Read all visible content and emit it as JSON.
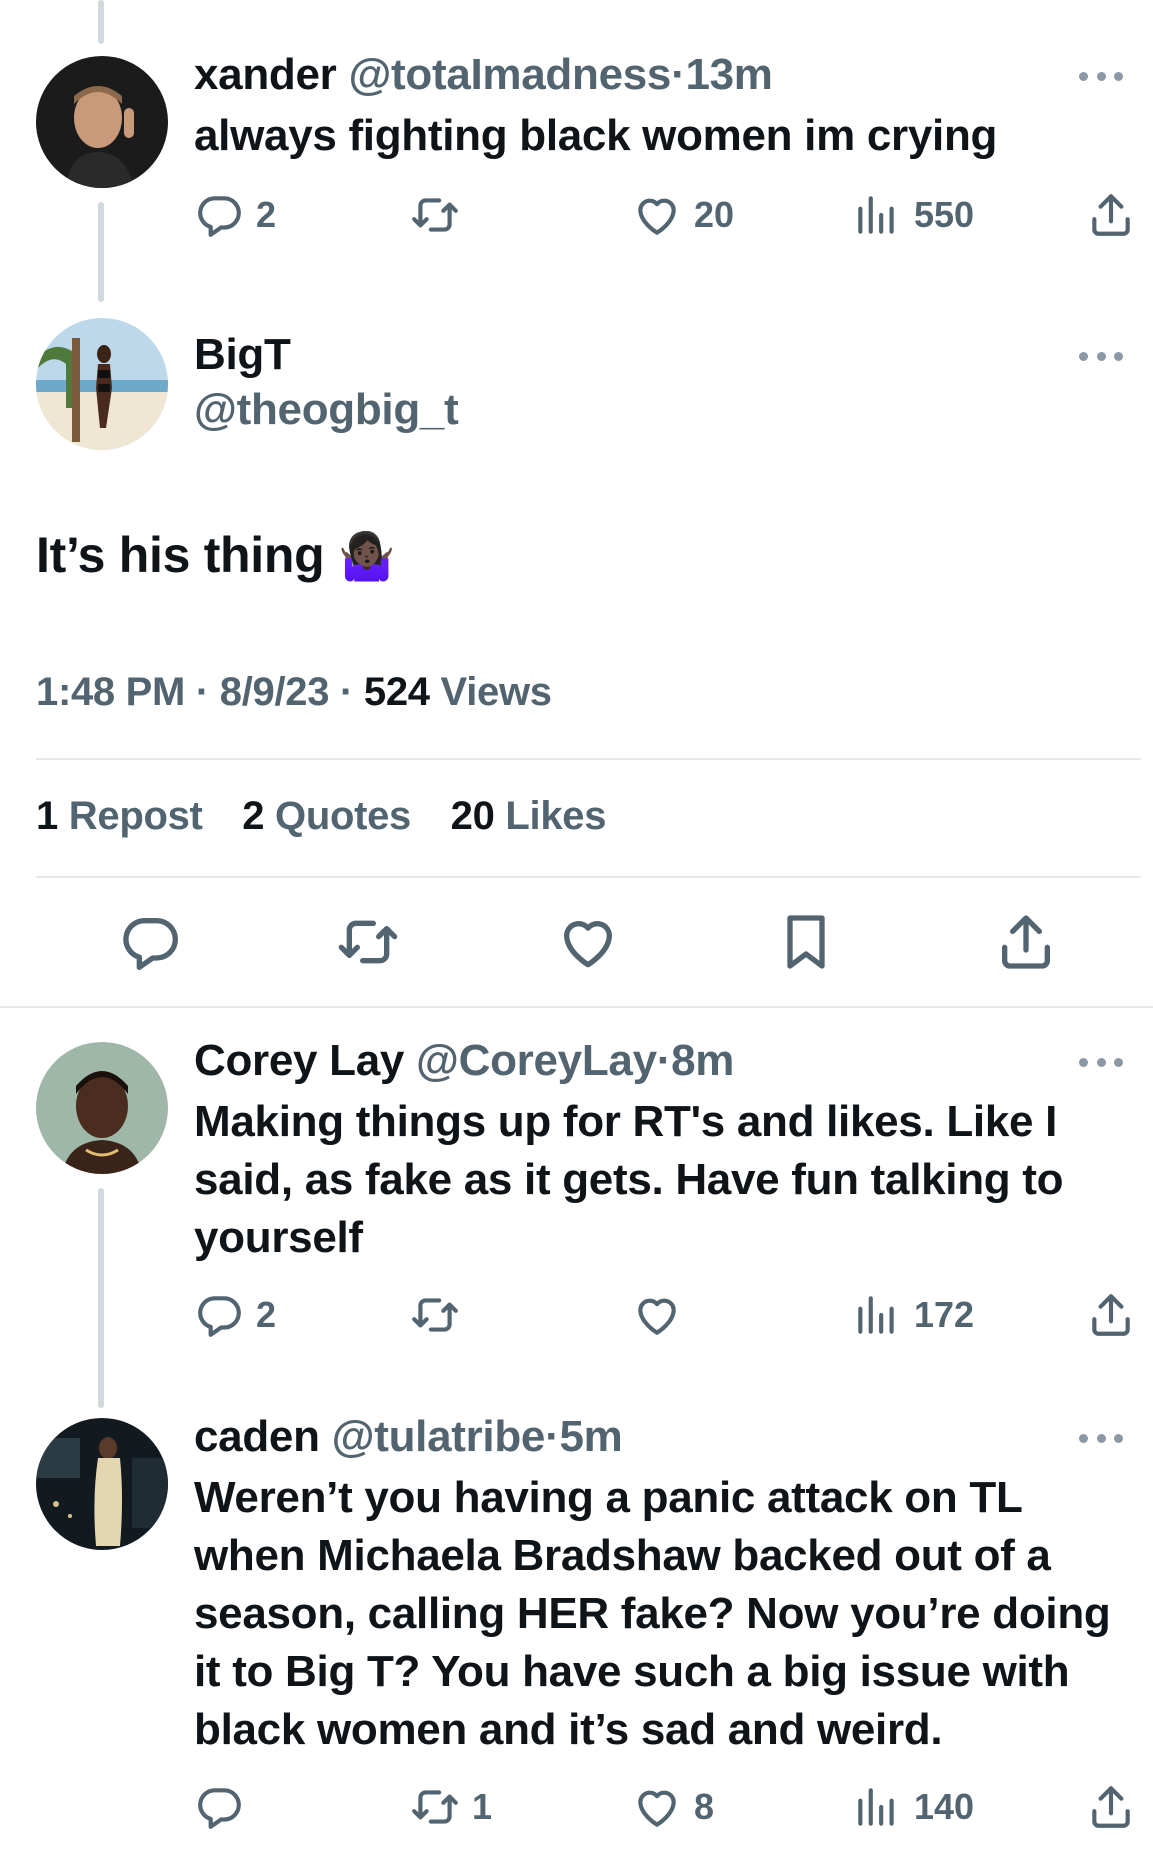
{
  "replies_top": [
    {
      "name": "xander",
      "handle": "@totaImadness",
      "dot": "·",
      "time": "13m",
      "text": "always fighting black women im crying",
      "stats": {
        "replies": "2",
        "reposts": "",
        "likes": "20",
        "views": "550"
      }
    }
  ],
  "main_tweet": {
    "name": "BigT",
    "handle": "@theogbig_t",
    "text": "It’s his thing",
    "emoji": "🤷🏿‍♀️",
    "time": "1:48 PM",
    "date": "8/9/23",
    "sep1": "·",
    "sep2": "·",
    "views_count": "524",
    "views_label": "Views",
    "reposts_count": "1",
    "reposts_label": "Repost",
    "quotes_count": "2",
    "quotes_label": "Quotes",
    "likes_count": "20",
    "likes_label": "Likes"
  },
  "replies_bottom": [
    {
      "name": "Corey Lay",
      "handle": "@CoreyLay",
      "dot": "·",
      "time": "8m",
      "text": "Making things up for RT's and likes. Like I said, as fake as it gets. Have fun talking to yourself",
      "stats": {
        "replies": "2",
        "reposts": "",
        "likes": "",
        "views": "172"
      }
    },
    {
      "name": "caden",
      "handle": "@tulatribe",
      "dot": "·",
      "time": "5m",
      "text": "Weren’t you having a panic attack on TL when Michaela Bradshaw backed out of a season, calling HER fake? Now you’re doing it to Big T? You have such a big issue with black women and it’s sad and weird.",
      "stats": {
        "replies": "",
        "reposts": "1",
        "likes": "8",
        "views": "140"
      }
    }
  ],
  "icons": {
    "reply": "reply-icon",
    "repost": "repost-icon",
    "like": "heart-icon",
    "views": "views-icon",
    "share": "share-icon",
    "bookmark": "bookmark-icon",
    "more": "more-icon"
  },
  "colors": {
    "text": "#0f1419",
    "secondary": "#536471",
    "divider": "#e6e9eb",
    "thread": "#cfd9de"
  }
}
